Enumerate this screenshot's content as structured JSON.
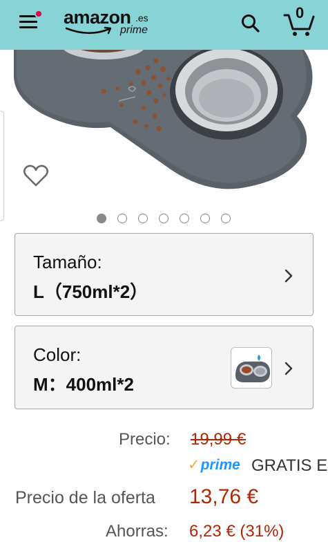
{
  "header": {
    "logo_text": "amazon",
    "logo_tld": ".es",
    "logo_prime": "prime",
    "cart_count": "0",
    "icons": {
      "menu": "hamburger-menu-icon",
      "search": "search-icon",
      "cart": "cart-icon"
    },
    "background_color": "#87d3d6",
    "notification_color": "#e6004c"
  },
  "gallery": {
    "image_count": 7,
    "active_index": 0,
    "favorite_icon": "heart-outline-icon"
  },
  "variations": {
    "size": {
      "label": "Tamaño:",
      "value": "L（750ml*2）"
    },
    "color": {
      "label": "Color:",
      "value": "M：400ml*2"
    }
  },
  "pricing": {
    "list_label": "Precio:",
    "list_price": "19,99 €",
    "prime_label": "prime",
    "shipping": "GRATIS E",
    "deal_label": "Precio de la oferta",
    "deal_price": "13,76 €",
    "savings_label": "Ahorras:",
    "savings": "6,23 € (31%)",
    "price_color": "#b12704",
    "prime_color": "#1a98ff"
  }
}
